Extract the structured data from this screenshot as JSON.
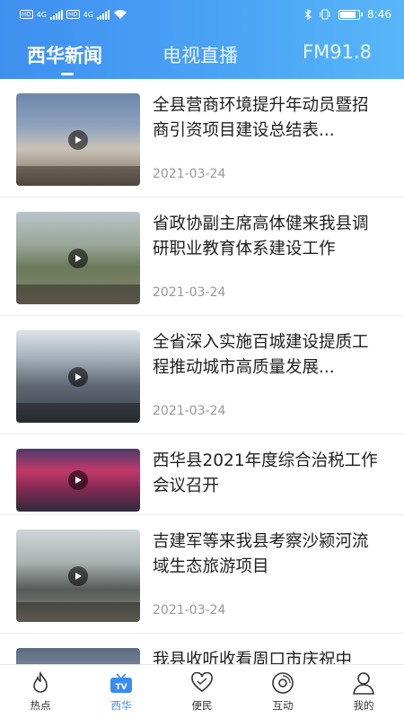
{
  "statusbar": {
    "time": "8:46",
    "net1": "4G",
    "net2": "4G",
    "hd": "HD"
  },
  "tabs": [
    {
      "label": "西华新闻",
      "active": true
    },
    {
      "label": "电视直播",
      "active": false
    },
    {
      "label": "FM91.8",
      "active": false
    }
  ],
  "news": [
    {
      "title": "全县营商环境提升年动员暨招商引资项目建设总结表...",
      "date": "2021-03-24",
      "has_video": true
    },
    {
      "title": "省政协副主席高体健来我县调研职业教育体系建设工作",
      "date": "2021-03-24",
      "has_video": true
    },
    {
      "title": "全省深入实施百城建设提质工程推动城市高质量发展...",
      "date": "2021-03-24",
      "has_video": true
    },
    {
      "title": "西华县2021年度综合治税工作会议召开",
      "date": "",
      "has_video": true
    },
    {
      "title": "吉建军等来我县考察沙颍河流域生态旅游项目",
      "date": "2021-03-24",
      "has_video": true
    },
    {
      "title": "我县收听收看周口市庆祝中",
      "date": "",
      "has_video": true
    }
  ],
  "bottom_nav": [
    {
      "label": "热点",
      "icon": "flame-icon",
      "active": false
    },
    {
      "label": "西华",
      "icon": "tv-icon",
      "active": true
    },
    {
      "label": "便民",
      "icon": "heart-icon",
      "active": false
    },
    {
      "label": "互动",
      "icon": "disc-icon",
      "active": false
    },
    {
      "label": "我的",
      "icon": "person-icon",
      "active": false
    }
  ],
  "colors": {
    "accent": "#3a8cf0",
    "header_start": "#3f8ff0",
    "header_end": "#58b6f7"
  }
}
